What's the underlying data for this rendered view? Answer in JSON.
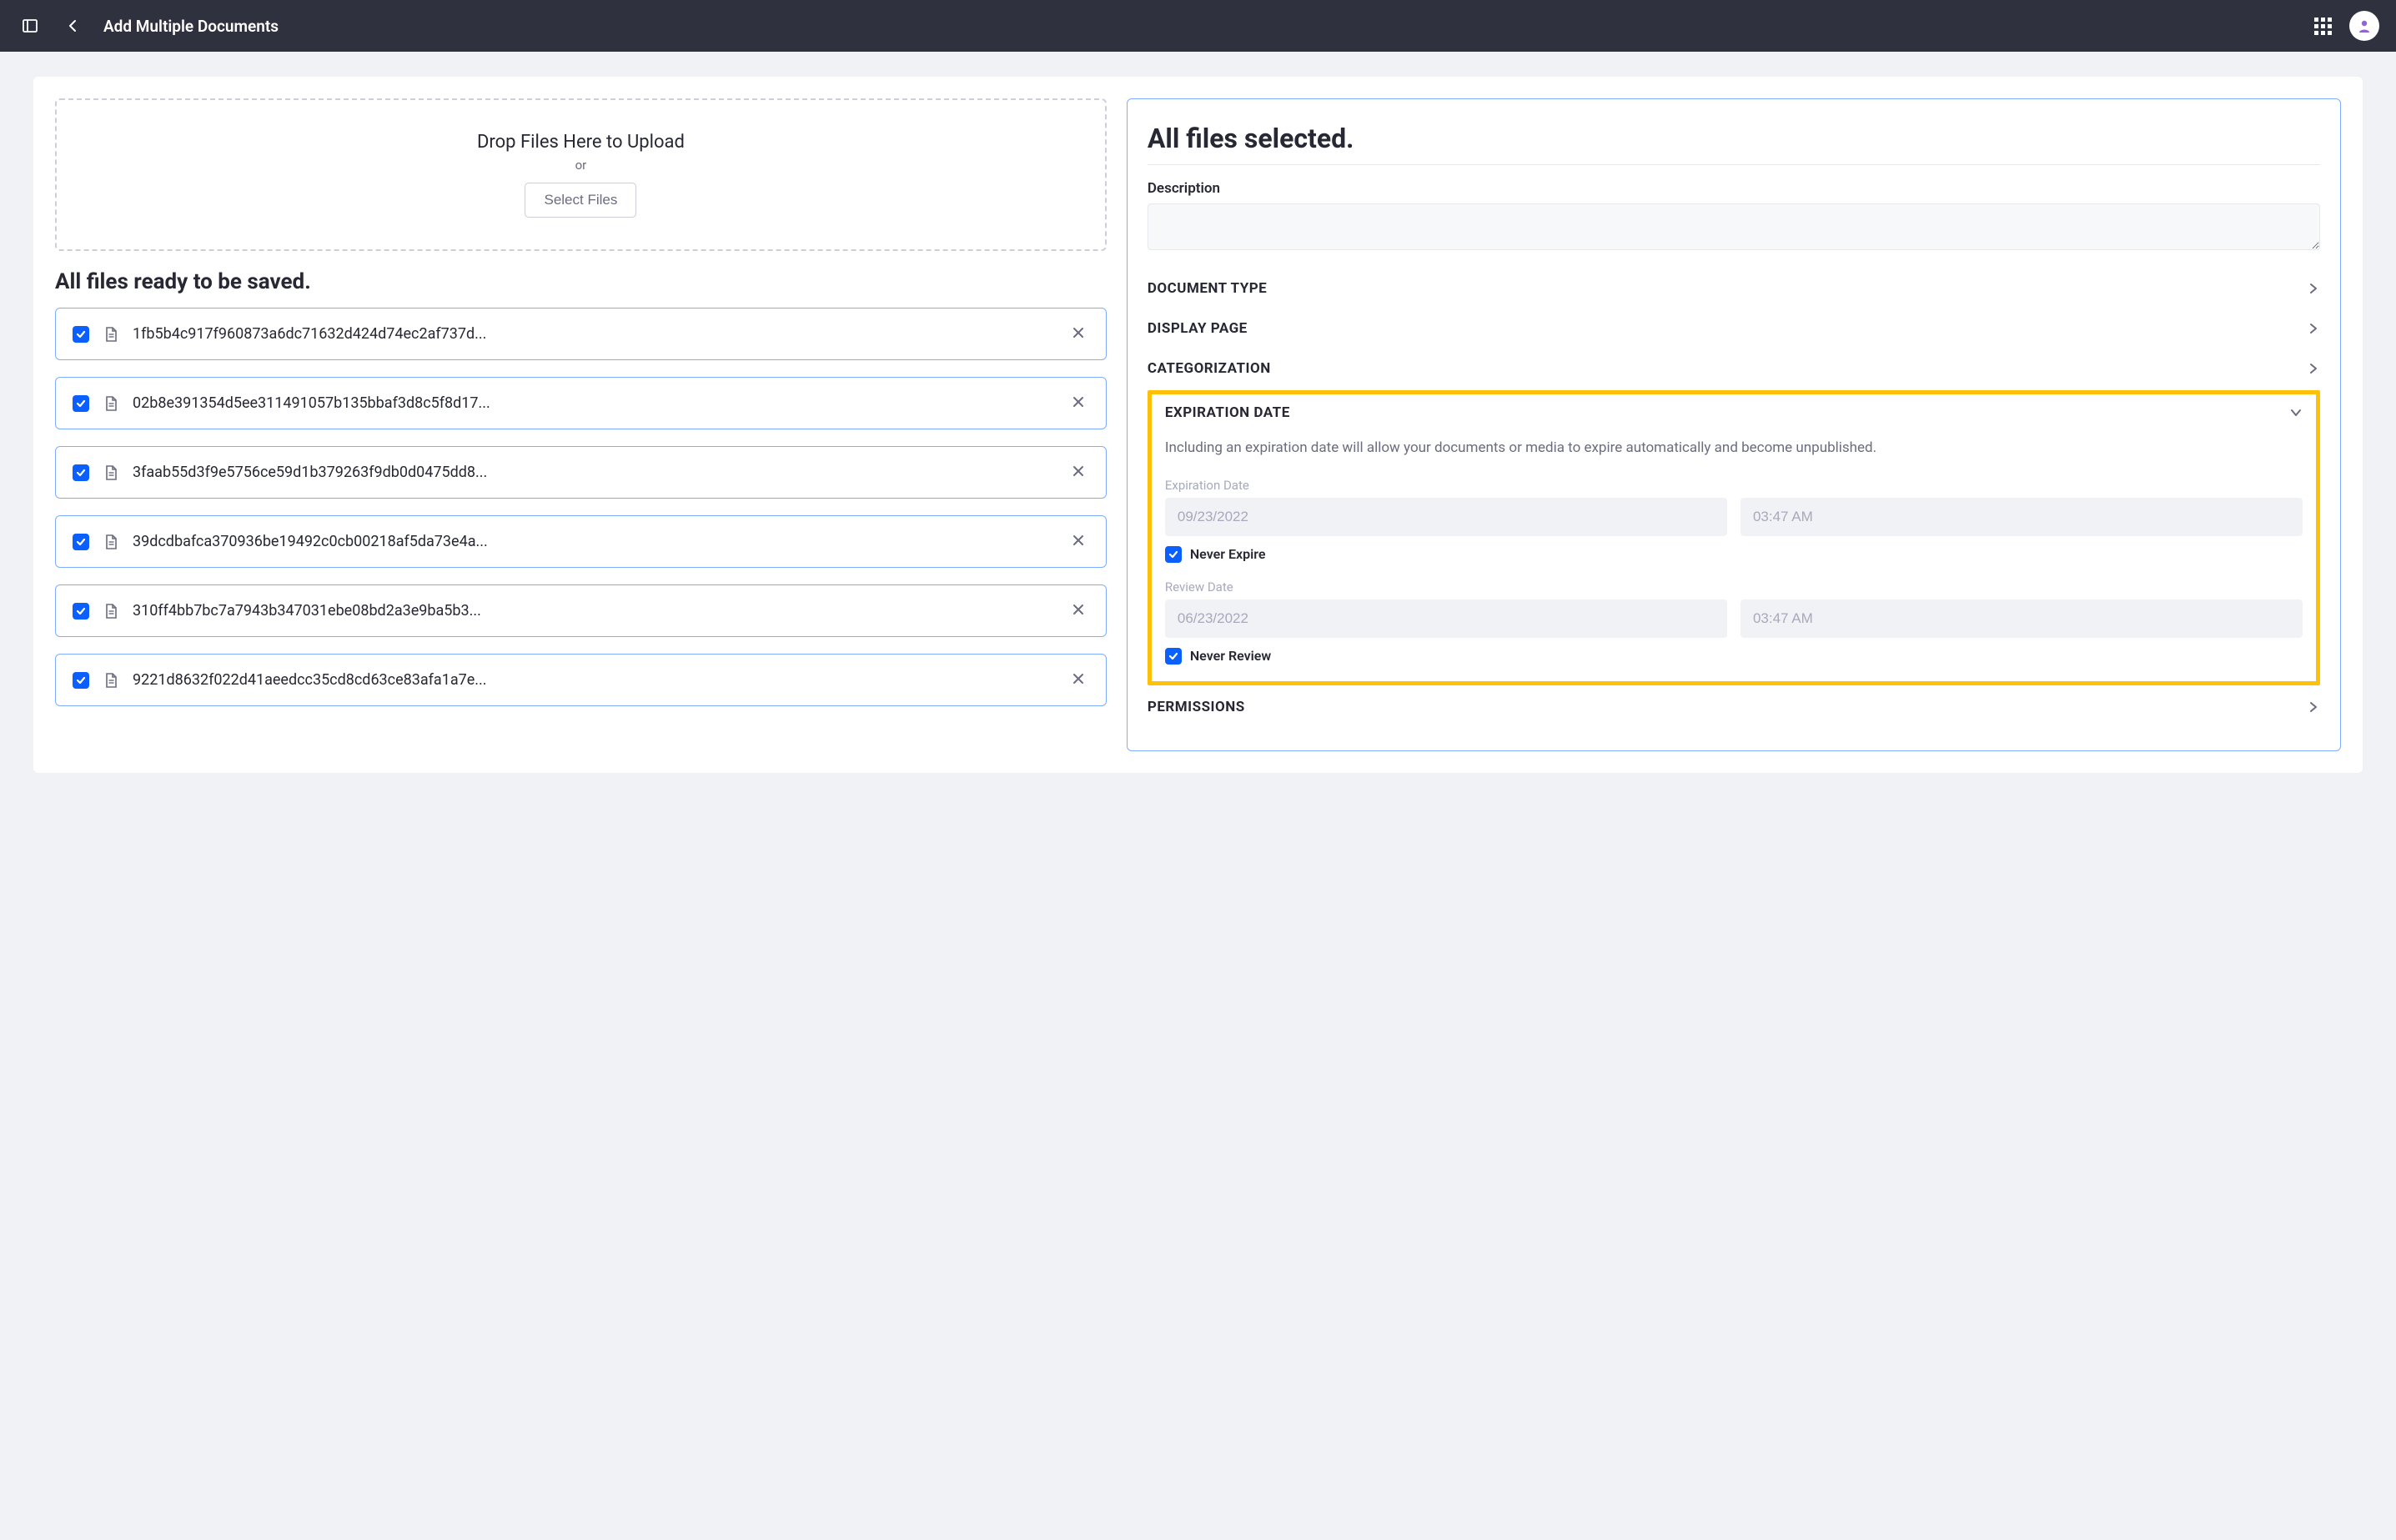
{
  "header": {
    "title": "Add Multiple Documents"
  },
  "dropzone": {
    "title": "Drop Files Here to Upload",
    "or": "or",
    "button": "Select Files"
  },
  "ready_title": "All files ready to be saved.",
  "files": [
    {
      "name": "1fb5b4c917f960873a6dc71632d424d74ec2af737d..."
    },
    {
      "name": "02b8e391354d5ee311491057b135bbaf3d8c5f8d17..."
    },
    {
      "name": "3faab55d3f9e5756ce59d1b379263f9db0d0475dd8..."
    },
    {
      "name": "39dcdbafca370936be19492c0cb00218af5da73e4a..."
    },
    {
      "name": "310ff4bb7bc7a7943b347031ebe08bd2a3e9ba5b3..."
    },
    {
      "name": "9221d8632f022d41aeedcc35cd8cd63ce83afa1a7e..."
    }
  ],
  "right": {
    "title": "All files selected.",
    "description_label": "Description",
    "sections": {
      "doc_type": "DOCUMENT TYPE",
      "display_page": "DISPLAY PAGE",
      "categorization": "CATEGORIZATION",
      "permissions": "PERMISSIONS"
    },
    "expiration": {
      "title": "EXPIRATION DATE",
      "description": "Including an expiration date will allow your documents or media to expire automatically and become unpublished.",
      "exp_date_label": "Expiration Date",
      "exp_date_value": "09/23/2022",
      "exp_time_value": "03:47 AM",
      "never_expire": "Never Expire",
      "review_date_label": "Review Date",
      "review_date_value": "06/23/2022",
      "review_time_value": "03:47 AM",
      "never_review": "Never Review"
    }
  }
}
